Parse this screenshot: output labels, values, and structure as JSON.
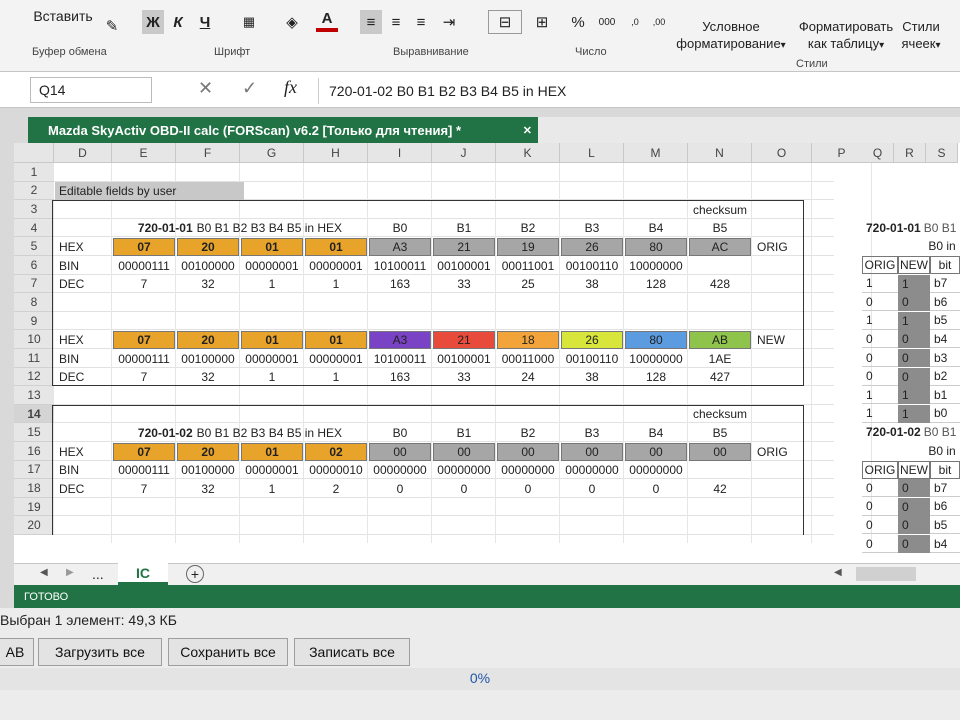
{
  "ribbon": {
    "paste": "Вставить",
    "bold": "Ж",
    "italic": "К",
    "underline": "Ч",
    "font_color_glyph": "А",
    "percent": "%",
    "cond_format": "Условное форматирование",
    "cond_format_arrow": "▾",
    "format_table": "Форматировать как таблицу",
    "format_table_arrow": "▾",
    "cell_styles": "Стили ячеек",
    "cell_styles_arrow": "▾",
    "g_clipboard": "Буфер обмена",
    "g_font": "Шрифт",
    "g_align": "Выравнивание",
    "g_number": "Число",
    "g_styles": "Стили"
  },
  "formula": {
    "name_box": "Q14",
    "fx": "fx",
    "content": "720-01-02 B0 B1 B2 B3 B4 B5 in HEX"
  },
  "workbook": {
    "title": "Mazda SkyActiv OBD-II calc (FORScan) v6.2  [Только для чтения] *"
  },
  "columns": [
    "D",
    "E",
    "F",
    "G",
    "H",
    "I",
    "J",
    "K",
    "L",
    "M",
    "N",
    "O",
    "P"
  ],
  "right_columns": [
    "Q",
    "R",
    "S"
  ],
  "rows": [
    "1",
    "2",
    "3",
    "4",
    "5",
    "6",
    "7",
    "8",
    "9",
    "10",
    "11",
    "12",
    "13",
    "14",
    "15",
    "16",
    "17",
    "18",
    "19",
    "20"
  ],
  "editable_label": "Editable fields by user",
  "block1": {
    "header": "720-01-01",
    "header_rest": "B0 B1 B2 B3 B4 B5 in HEX",
    "byte_labels": [
      "B0",
      "B1",
      "B2",
      "B3",
      "B4",
      "B5"
    ],
    "checksum": "checksum",
    "hex_label": "HEX",
    "bin_label": "BIN",
    "dec_label": "DEC",
    "orig_tag": "ORIG",
    "new_tag": "NEW",
    "orig_hex": [
      "07",
      "20",
      "01",
      "01",
      "A3",
      "21",
      "19",
      "26",
      "80",
      "AC"
    ],
    "orig_bin": [
      "00000111",
      "00100000",
      "00000001",
      "00000001",
      "10100011",
      "00100001",
      "00011001",
      "00100110",
      "10000000",
      ""
    ],
    "orig_dec": [
      "7",
      "32",
      "1",
      "1",
      "163",
      "33",
      "25",
      "38",
      "128",
      "428"
    ],
    "new_hex": [
      "07",
      "20",
      "01",
      "01",
      "A3",
      "21",
      "18",
      "26",
      "80",
      "AB"
    ],
    "new_bin": [
      "00000111",
      "00100000",
      "00000001",
      "00000001",
      "10100011",
      "00100001",
      "00011000",
      "00100110",
      "10000000",
      "1AE"
    ],
    "new_dec": [
      "7",
      "32",
      "1",
      "1",
      "163",
      "33",
      "24",
      "38",
      "128",
      "427"
    ]
  },
  "block2": {
    "header": "720-01-02",
    "header_rest": "B0 B1 B2 B3 B4 B5 in HEX",
    "byte_labels": [
      "B0",
      "B1",
      "B2",
      "B3",
      "B4",
      "B5"
    ],
    "checksum": "checksum",
    "orig_hex": [
      "07",
      "20",
      "01",
      "02",
      "00",
      "00",
      "00",
      "00",
      "00",
      "00"
    ],
    "orig_bin": [
      "00000111",
      "00100000",
      "00000001",
      "00000010",
      "00000000",
      "00000000",
      "00000000",
      "00000000",
      "00000000",
      ""
    ],
    "orig_dec": [
      "7",
      "32",
      "1",
      "2",
      "0",
      "0",
      "0",
      "0",
      "0",
      "42"
    ]
  },
  "side1": {
    "header": "720-01-01",
    "header_rest": "B0 B1",
    "sub": "B0 in",
    "cols": [
      "ORIG",
      "NEW",
      "bit"
    ],
    "orig": [
      "1",
      "0",
      "1",
      "0",
      "0",
      "0",
      "1",
      "1"
    ],
    "new": [
      "1",
      "0",
      "1",
      "0",
      "0",
      "0",
      "1",
      "1"
    ],
    "bits": [
      "b7",
      "b6",
      "b5",
      "b4",
      "b3",
      "b2",
      "b1",
      "b0"
    ]
  },
  "side2": {
    "header": "720-01-02",
    "header_rest": "B0 B1",
    "sub": "B0 in",
    "cols": [
      "ORIG",
      "NEW",
      "bit"
    ],
    "orig": [
      "0",
      "0",
      "0",
      "0"
    ],
    "new": [
      "0",
      "0",
      "0",
      "0"
    ],
    "bits": [
      "b7",
      "b6",
      "b5",
      "b4"
    ]
  },
  "sheet": {
    "tab": "IC",
    "more": "...",
    "add": "+"
  },
  "status": {
    "ready": "ГОТОВО"
  },
  "app": {
    "selected": "Выбран 1 элемент: 49,3 КБ",
    "btn_ab": "АВ",
    "btn_load": "Загрузить все",
    "btn_save": "Сохранить все",
    "btn_write": "Записать все",
    "progress": "0%",
    "progress_value": 0
  },
  "colors": {
    "excel_green": "#217346",
    "amber": "#e8a32b",
    "gray": "#a6a6a6",
    "purple": "#7a42c4",
    "red": "#e84b3c",
    "orange": "#f2a33a",
    "yellow": "#d8e53a",
    "blue": "#5b9be0",
    "green": "#8ec44b"
  }
}
